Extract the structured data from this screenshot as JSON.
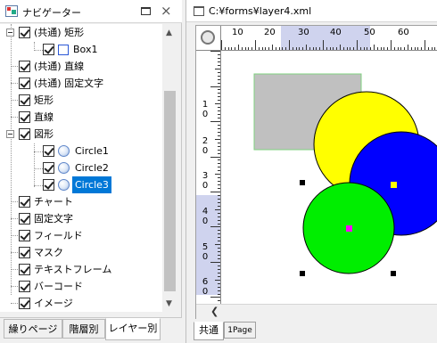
{
  "navigator": {
    "title": "ナビゲーター",
    "items": [
      {
        "label": "(共通) 矩形"
      },
      {
        "label": "Box1"
      },
      {
        "label": "(共通) 直線"
      },
      {
        "label": "(共通) 固定文字"
      },
      {
        "label": "矩形"
      },
      {
        "label": "直線"
      },
      {
        "label": "図形"
      },
      {
        "label": "Circle1"
      },
      {
        "label": "Circle2"
      },
      {
        "label": "Circle3"
      },
      {
        "label": "チャート"
      },
      {
        "label": "固定文字"
      },
      {
        "label": "フィールド"
      },
      {
        "label": "マスク"
      },
      {
        "label": "テキストフレーム"
      },
      {
        "label": "バーコード"
      },
      {
        "label": "イメージ"
      }
    ],
    "tabs": [
      {
        "label": "繰りページ"
      },
      {
        "label": "階層別"
      },
      {
        "label": "レイヤー別"
      }
    ]
  },
  "document": {
    "path": "C:¥forms¥layer4.xml",
    "ruler_h": [
      "10",
      "20",
      "30",
      "40",
      "50",
      "60"
    ],
    "ruler_v": [
      {
        "top": "1",
        "bottom": "0"
      },
      {
        "top": "2",
        "bottom": "0"
      },
      {
        "top": "3",
        "bottom": "0"
      },
      {
        "top": "4",
        "bottom": "0"
      },
      {
        "top": "5",
        "bottom": "0"
      },
      {
        "top": "6",
        "bottom": "0"
      },
      {
        "top": "7",
        "bottom": "0"
      }
    ],
    "tabs": [
      {
        "label": "共通"
      },
      {
        "label": "1Page"
      }
    ]
  },
  "colors": {
    "rect_fill": "#c0c0c0",
    "rect_border": "#7fd07f",
    "circle1": "#ffff00",
    "circle2": "#0000ff",
    "circle3": "#00ee00",
    "handle_marker": "#ff00ff",
    "center_marker": "#ffff00",
    "selection": "#0078d7"
  }
}
